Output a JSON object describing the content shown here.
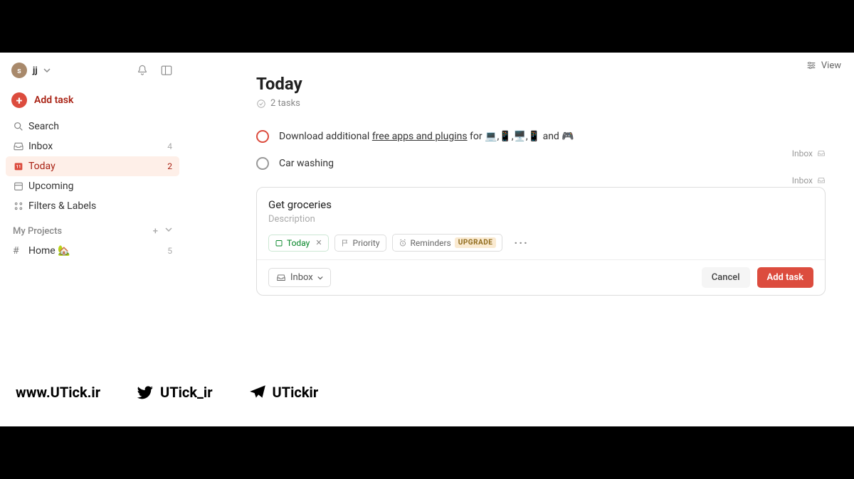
{
  "header": {
    "avatar_letter": "s",
    "username": "jj",
    "view_label": "View"
  },
  "sidebar": {
    "add_task_label": "Add task",
    "items": [
      {
        "icon": "search",
        "label": "Search",
        "count": ""
      },
      {
        "icon": "inbox",
        "label": "Inbox",
        "count": "4"
      },
      {
        "icon": "today",
        "label": "Today",
        "count": "2"
      },
      {
        "icon": "upcoming",
        "label": "Upcoming",
        "count": ""
      },
      {
        "icon": "filters",
        "label": "Filters & Labels",
        "count": ""
      }
    ],
    "section_title": "My Projects",
    "projects": [
      {
        "label": "Home 🏡",
        "count": "5"
      }
    ]
  },
  "main": {
    "title": "Today",
    "task_count_text": "2 tasks",
    "tasks": [
      {
        "title_pre": "Download additional ",
        "title_link": "free apps and plugins",
        "title_post": " for 💻,📱,🖥️,📱 and 🎮",
        "project": "Inbox",
        "priority": true
      },
      {
        "title_pre": "Car washing",
        "title_link": "",
        "title_post": "",
        "project": "Inbox",
        "priority": false
      }
    ],
    "editor": {
      "title_value": "Get groceries",
      "desc_placeholder": "Description",
      "chip_date": "Today",
      "chip_priority": "Priority",
      "chip_reminders": "Reminders",
      "upgrade_label": "UPGRADE",
      "project_label": "Inbox",
      "cancel_label": "Cancel",
      "add_label": "Add task"
    }
  },
  "footer": {
    "website": "www.UTick.ir",
    "twitter": "UTick_ir",
    "telegram": "UTickir"
  }
}
